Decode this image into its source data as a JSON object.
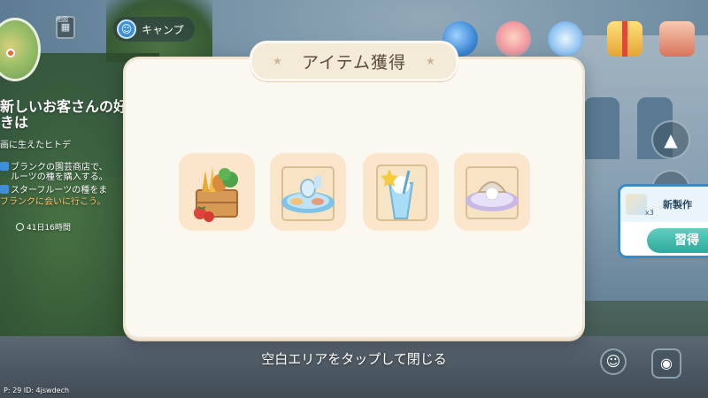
{
  "hud": {
    "map_icon_label": "地図",
    "camp_label": "キャンプ",
    "quest": {
      "title": "新しいお客さんの好きは",
      "subtitle": "画に生えたヒトデ",
      "lines": [
        "ブランクの園芸商店で、",
        "ルーツの種を購入する。",
        "スターフルーツの種をま",
        "ブランクに会いに行こう。"
      ],
      "timer": "41日16時間"
    },
    "side_card": {
      "count": "x3",
      "title": "新製作",
      "learn_button": "習得"
    },
    "player_info": "P: 29    ID: 4jswdech"
  },
  "modal": {
    "title": "アイテム獲得",
    "items": [
      {
        "name": "vegetable-crate-item"
      },
      {
        "name": "seafood-platter-recipe-item"
      },
      {
        "name": "star-drink-recipe-item"
      },
      {
        "name": "pearl-dish-recipe-item"
      }
    ]
  },
  "hint": "空白エリアをタップして閉じる",
  "colors": {
    "modal_bg": "#fbf8f2",
    "tile_bg": "#fbe6cc",
    "title_tab_bg": "#f4ead8",
    "title_text": "#5e4a3a",
    "learn_button": "#2fa89b"
  }
}
